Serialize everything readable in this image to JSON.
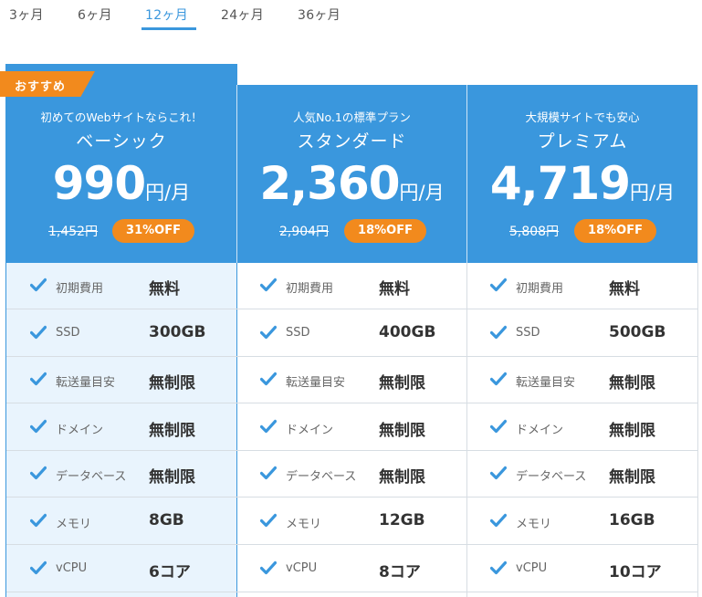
{
  "tabs": [
    {
      "label": "3ヶ月",
      "active": false
    },
    {
      "label": "6ヶ月",
      "active": false
    },
    {
      "label": "12ヶ月",
      "active": true
    },
    {
      "label": "24ヶ月",
      "active": false
    },
    {
      "label": "36ヶ月",
      "active": false
    }
  ],
  "colors": {
    "accent": "#3a97dd",
    "badge": "#f28a1d",
    "highlight_bg": "#e9f4fd"
  },
  "ribbon": "おすすめ",
  "plans": [
    {
      "subtitle": "初めてのWebサイトならこれ！",
      "name": "ベーシック",
      "price": "990",
      "unit": "円/月",
      "old_price": "1,452円",
      "discount": "31%OFF",
      "features": [
        {
          "label": "初期費用",
          "value": "無料"
        },
        {
          "label": "SSD",
          "value": "300GB"
        },
        {
          "label": "転送量目安",
          "value": "無制限"
        },
        {
          "label": "ドメイン",
          "value": "無制限"
        },
        {
          "label": "データベース",
          "value": "無制限"
        },
        {
          "label": "メモリ",
          "value": "8GB"
        },
        {
          "label": "vCPU",
          "value": "6コア"
        }
      ]
    },
    {
      "subtitle": "人気No.1の標準プラン",
      "name": "スタンダード",
      "price": "2,360",
      "unit": "円/月",
      "old_price": "2,904円",
      "discount": "18%OFF",
      "features": [
        {
          "label": "初期費用",
          "value": "無料"
        },
        {
          "label": "SSD",
          "value": "400GB"
        },
        {
          "label": "転送量目安",
          "value": "無制限"
        },
        {
          "label": "ドメイン",
          "value": "無制限"
        },
        {
          "label": "データベース",
          "value": "無制限"
        },
        {
          "label": "メモリ",
          "value": "12GB"
        },
        {
          "label": "vCPU",
          "value": "8コア"
        }
      ]
    },
    {
      "subtitle": "大規模サイトでも安心",
      "name": "プレミアム",
      "price": "4,719",
      "unit": "円/月",
      "old_price": "5,808円",
      "discount": "18%OFF",
      "features": [
        {
          "label": "初期費用",
          "value": "無料"
        },
        {
          "label": "SSD",
          "value": "500GB"
        },
        {
          "label": "転送量目安",
          "value": "無制限"
        },
        {
          "label": "ドメイン",
          "value": "無制限"
        },
        {
          "label": "データベース",
          "value": "無制限"
        },
        {
          "label": "メモリ",
          "value": "16GB"
        },
        {
          "label": "vCPU",
          "value": "10コア"
        }
      ]
    }
  ]
}
